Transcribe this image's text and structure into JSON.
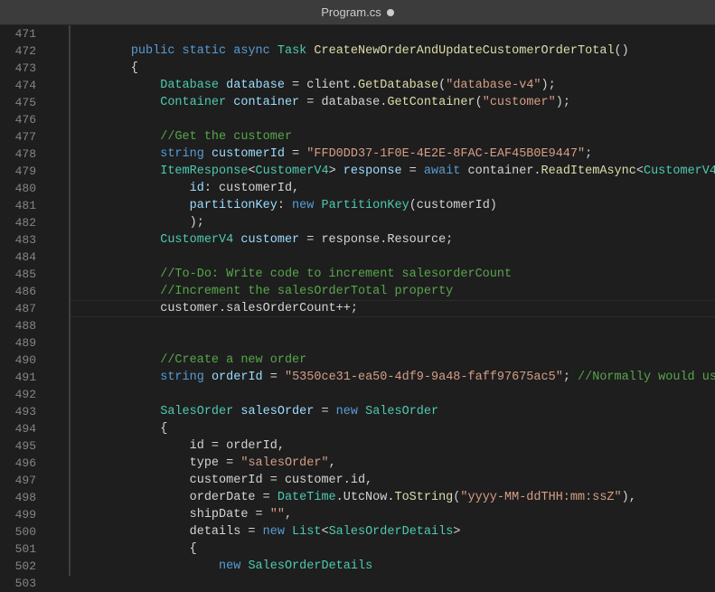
{
  "tab": {
    "filename": "Program.cs",
    "modified": true
  },
  "editor": {
    "first_line_number": 471,
    "current_line_number": 487,
    "lines": [
      [],
      [
        {
          "cls": "plain",
          "txt": "        "
        },
        {
          "cls": "kw",
          "txt": "public"
        },
        {
          "cls": "plain",
          "txt": " "
        },
        {
          "cls": "kw",
          "txt": "static"
        },
        {
          "cls": "plain",
          "txt": " "
        },
        {
          "cls": "kw",
          "txt": "async"
        },
        {
          "cls": "plain",
          "txt": " "
        },
        {
          "cls": "type",
          "txt": "Task"
        },
        {
          "cls": "plain",
          "txt": " "
        },
        {
          "cls": "method",
          "txt": "CreateNewOrderAndUpdateCustomerOrderTotal"
        },
        {
          "cls": "plain",
          "txt": "()"
        }
      ],
      [
        {
          "cls": "plain",
          "txt": "        {"
        }
      ],
      [
        {
          "cls": "plain",
          "txt": "            "
        },
        {
          "cls": "type",
          "txt": "Database"
        },
        {
          "cls": "plain",
          "txt": " "
        },
        {
          "cls": "local",
          "txt": "database"
        },
        {
          "cls": "plain",
          "txt": " = client."
        },
        {
          "cls": "method",
          "txt": "GetDatabase"
        },
        {
          "cls": "plain",
          "txt": "("
        },
        {
          "cls": "str",
          "txt": "\"database-v4\""
        },
        {
          "cls": "plain",
          "txt": ");"
        }
      ],
      [
        {
          "cls": "plain",
          "txt": "            "
        },
        {
          "cls": "type",
          "txt": "Container"
        },
        {
          "cls": "plain",
          "txt": " "
        },
        {
          "cls": "local",
          "txt": "container"
        },
        {
          "cls": "plain",
          "txt": " = database."
        },
        {
          "cls": "method",
          "txt": "GetContainer"
        },
        {
          "cls": "plain",
          "txt": "("
        },
        {
          "cls": "str",
          "txt": "\"customer\""
        },
        {
          "cls": "plain",
          "txt": ");"
        }
      ],
      [],
      [
        {
          "cls": "plain",
          "txt": "            "
        },
        {
          "cls": "comment",
          "txt": "//Get the customer"
        }
      ],
      [
        {
          "cls": "plain",
          "txt": "            "
        },
        {
          "cls": "kw",
          "txt": "string"
        },
        {
          "cls": "plain",
          "txt": " "
        },
        {
          "cls": "local",
          "txt": "customerId"
        },
        {
          "cls": "plain",
          "txt": " = "
        },
        {
          "cls": "str",
          "txt": "\"FFD0DD37-1F0E-4E2E-8FAC-EAF45B0E9447\""
        },
        {
          "cls": "plain",
          "txt": ";"
        }
      ],
      [
        {
          "cls": "plain",
          "txt": "            "
        },
        {
          "cls": "type",
          "txt": "ItemResponse"
        },
        {
          "cls": "plain",
          "txt": "<"
        },
        {
          "cls": "type",
          "txt": "CustomerV4"
        },
        {
          "cls": "plain",
          "txt": "> "
        },
        {
          "cls": "local",
          "txt": "response"
        },
        {
          "cls": "plain",
          "txt": " = "
        },
        {
          "cls": "kw",
          "txt": "await"
        },
        {
          "cls": "plain",
          "txt": " container."
        },
        {
          "cls": "method",
          "txt": "ReadItemAsync"
        },
        {
          "cls": "plain",
          "txt": "<"
        },
        {
          "cls": "type",
          "txt": "CustomerV4"
        },
        {
          "cls": "plain",
          "txt": ">("
        }
      ],
      [
        {
          "cls": "plain",
          "txt": "                "
        },
        {
          "cls": "param",
          "txt": "id"
        },
        {
          "cls": "plain",
          "txt": ": customerId,"
        }
      ],
      [
        {
          "cls": "plain",
          "txt": "                "
        },
        {
          "cls": "param",
          "txt": "partitionKey"
        },
        {
          "cls": "plain",
          "txt": ": "
        },
        {
          "cls": "kw",
          "txt": "new"
        },
        {
          "cls": "plain",
          "txt": " "
        },
        {
          "cls": "type",
          "txt": "PartitionKey"
        },
        {
          "cls": "plain",
          "txt": "(customerId)"
        }
      ],
      [
        {
          "cls": "plain",
          "txt": "                );"
        }
      ],
      [
        {
          "cls": "plain",
          "txt": "            "
        },
        {
          "cls": "type",
          "txt": "CustomerV4"
        },
        {
          "cls": "plain",
          "txt": " "
        },
        {
          "cls": "local",
          "txt": "customer"
        },
        {
          "cls": "plain",
          "txt": " = response.Resource;"
        }
      ],
      [],
      [
        {
          "cls": "plain",
          "txt": "            "
        },
        {
          "cls": "comment",
          "txt": "//To-Do: Write code to increment salesorderCount"
        }
      ],
      [
        {
          "cls": "plain",
          "txt": "            "
        },
        {
          "cls": "comment",
          "txt": "//Increment the salesOrderTotal property"
        }
      ],
      [
        {
          "cls": "plain",
          "txt": "            customer.salesOrderCount++;"
        }
      ],
      [],
      [],
      [
        {
          "cls": "plain",
          "txt": "            "
        },
        {
          "cls": "comment",
          "txt": "//Create a new order"
        }
      ],
      [
        {
          "cls": "plain",
          "txt": "            "
        },
        {
          "cls": "kw",
          "txt": "string"
        },
        {
          "cls": "plain",
          "txt": " "
        },
        {
          "cls": "local",
          "txt": "orderId"
        },
        {
          "cls": "plain",
          "txt": " = "
        },
        {
          "cls": "str",
          "txt": "\"5350ce31-ea50-4df9-9a48-faff97675ac5\""
        },
        {
          "cls": "plain",
          "txt": "; "
        },
        {
          "cls": "comment",
          "txt": "//Normally would use Guid"
        }
      ],
      [],
      [
        {
          "cls": "plain",
          "txt": "            "
        },
        {
          "cls": "type",
          "txt": "SalesOrder"
        },
        {
          "cls": "plain",
          "txt": " "
        },
        {
          "cls": "local",
          "txt": "salesOrder"
        },
        {
          "cls": "plain",
          "txt": " = "
        },
        {
          "cls": "kw",
          "txt": "new"
        },
        {
          "cls": "plain",
          "txt": " "
        },
        {
          "cls": "type",
          "txt": "SalesOrder"
        }
      ],
      [
        {
          "cls": "plain",
          "txt": "            {"
        }
      ],
      [
        {
          "cls": "plain",
          "txt": "                id = orderId,"
        }
      ],
      [
        {
          "cls": "plain",
          "txt": "                type = "
        },
        {
          "cls": "str",
          "txt": "\"salesOrder\""
        },
        {
          "cls": "plain",
          "txt": ","
        }
      ],
      [
        {
          "cls": "plain",
          "txt": "                customerId = customer.id,"
        }
      ],
      [
        {
          "cls": "plain",
          "txt": "                orderDate = "
        },
        {
          "cls": "type",
          "txt": "DateTime"
        },
        {
          "cls": "plain",
          "txt": ".UtcNow."
        },
        {
          "cls": "method",
          "txt": "ToString"
        },
        {
          "cls": "plain",
          "txt": "("
        },
        {
          "cls": "str",
          "txt": "\"yyyy-MM-ddTHH:mm:ssZ\""
        },
        {
          "cls": "plain",
          "txt": "),"
        }
      ],
      [
        {
          "cls": "plain",
          "txt": "                shipDate = "
        },
        {
          "cls": "str",
          "txt": "\"\""
        },
        {
          "cls": "plain",
          "txt": ","
        }
      ],
      [
        {
          "cls": "plain",
          "txt": "                details = "
        },
        {
          "cls": "kw",
          "txt": "new"
        },
        {
          "cls": "plain",
          "txt": " "
        },
        {
          "cls": "type",
          "txt": "List"
        },
        {
          "cls": "plain",
          "txt": "<"
        },
        {
          "cls": "type",
          "txt": "SalesOrderDetails"
        },
        {
          "cls": "plain",
          "txt": ">"
        }
      ],
      [
        {
          "cls": "plain",
          "txt": "                {"
        }
      ],
      [
        {
          "cls": "plain",
          "txt": "                    "
        },
        {
          "cls": "kw",
          "txt": "new"
        },
        {
          "cls": "plain",
          "txt": " "
        },
        {
          "cls": "type",
          "txt": "SalesOrderDetails"
        }
      ],
      [
        {
          "cls": "plain",
          "txt": "                    {"
        }
      ]
    ]
  }
}
